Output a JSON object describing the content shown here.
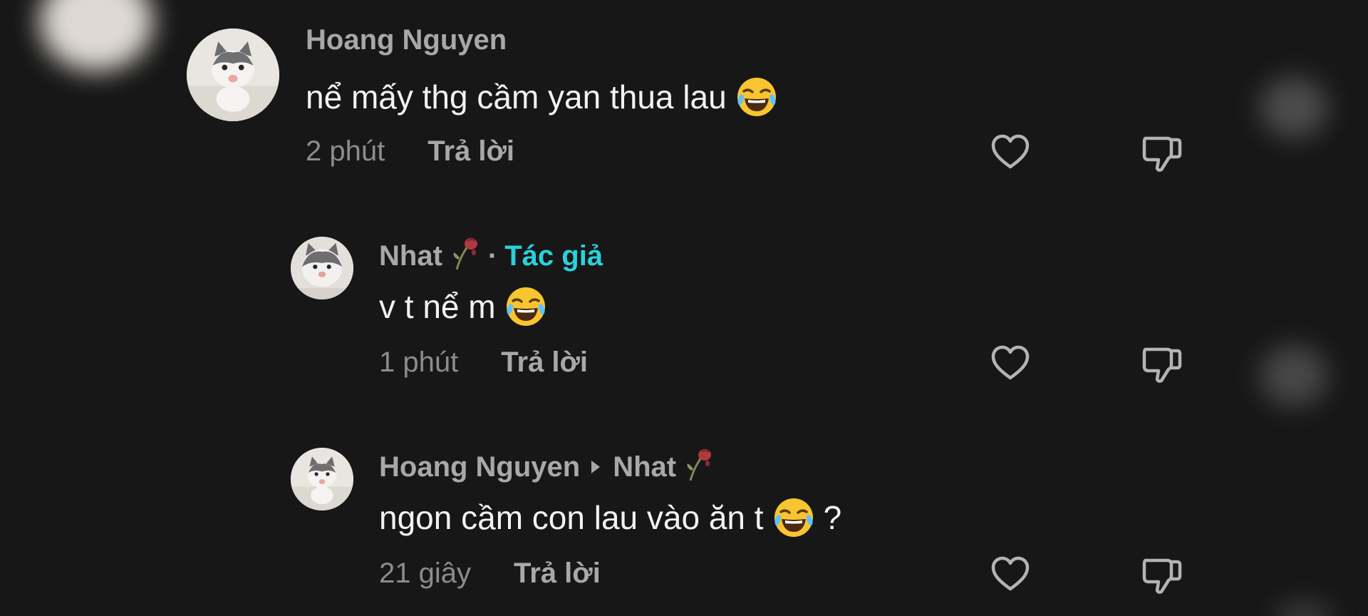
{
  "comments": [
    {
      "username": "Hoang Nguyen",
      "text": "nể mấy thg cầm yan thua lau",
      "time": "2 phút",
      "reply_label": "Trả lời",
      "emoji": "laughing-tears-emoji"
    },
    {
      "username": "Nhat",
      "separator": "·",
      "author_tag": "Tác giả",
      "text": "v t nể m",
      "time": "1 phút",
      "reply_label": "Trả lời",
      "emoji": "laughing-tears-emoji",
      "name_emoji": "wilted-rose-emoji"
    },
    {
      "username": "Hoang Nguyen",
      "reply_to": "Nhat",
      "text": "ngon cầm con lau vào ăn t",
      "text_suffix": "?",
      "time": "21 giây",
      "reply_label": "Trả lời",
      "emoji": "laughing-tears-emoji",
      "name_emoji": "wilted-rose-emoji"
    }
  ],
  "icons": {
    "like": "heart-icon",
    "dislike": "thumbs-down-icon"
  },
  "colors": {
    "background": "#171717",
    "author_tag": "#28d2dc",
    "username": "#a8a8a8",
    "body_text": "#f2f2f2",
    "timestamp": "#8c8c8c"
  }
}
